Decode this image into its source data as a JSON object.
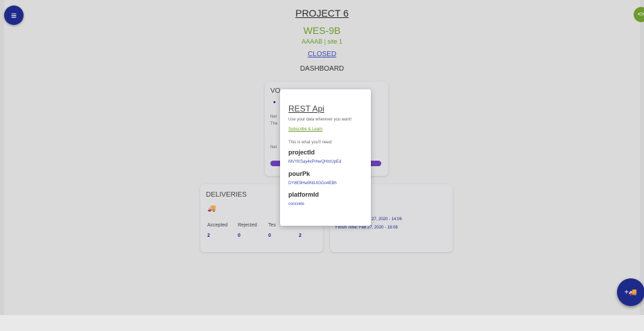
{
  "header": {
    "project_title": "PROJECT 6",
    "wes_title": "WES-9B",
    "site_line": "AAAAB | site 1",
    "status": "CLOSED",
    "dashboard": "DASHBOARD"
  },
  "icons": {
    "menu": "≡",
    "code": "<>",
    "volume": "•",
    "truck": "🚚",
    "add_truck": "+🚚"
  },
  "volumes": {
    "title": "VO",
    "net1": "Net",
    "the": "The",
    "net2": "Net",
    "progress_fraction": 1.0
  },
  "deliveries": {
    "title": "DELIVERIES",
    "headers": [
      "Accepted",
      "Rejected",
      "Tes"
    ],
    "values": [
      "2",
      "0",
      "0",
      "2"
    ]
  },
  "times": {
    "start": "27, 2020 - 14:06",
    "finish": "Finish Time: Feb 27, 2020 - 18:08"
  },
  "modal": {
    "title": "REST Api",
    "subtitle": "Use your data wherever you want!",
    "subscribe_link": "Subscribe & Learn",
    "need_text": "This is what you'll need:",
    "fields": [
      {
        "key": "projectId",
        "value": "MVYKSay4xPrhwQHmUpEd"
      },
      {
        "key": "pourPk",
        "value": "DY8E9Hw0NlUiGGo4EBh"
      },
      {
        "key": "platformId",
        "value": "concrete"
      }
    ]
  },
  "colors": {
    "primary": "#1e2a8a",
    "accent_green": "#6d9a2f",
    "link_blue": "#3c4bb0",
    "progress": "#6a3fb2"
  }
}
